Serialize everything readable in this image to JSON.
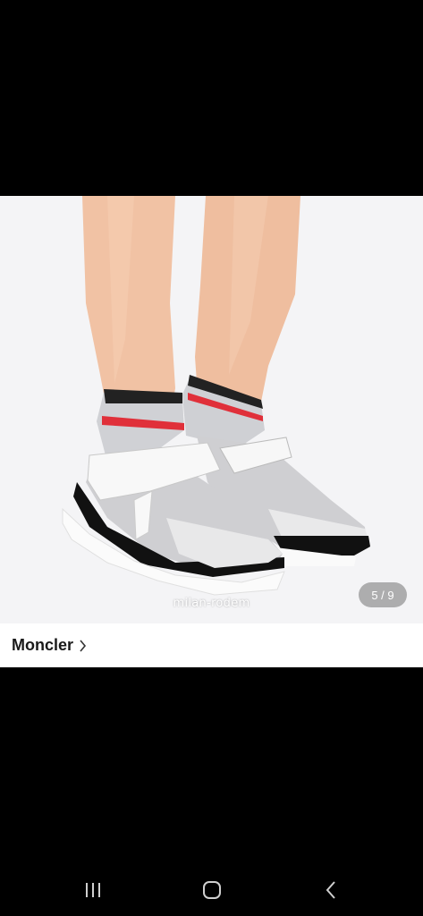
{
  "product_image": {
    "alt_icon": "sneaker-photo",
    "watermark": "milan-rodem",
    "counter": "5 / 9"
  },
  "brand": {
    "name": "Moncler",
    "chevron_icon": "chevron-right-icon"
  },
  "navbar": {
    "recents_icon": "recents-icon",
    "home_icon": "home-icon",
    "back_icon": "back-icon"
  },
  "colors": {
    "background": "#000000",
    "photo_bg": "#f4f4f6",
    "stripe_red": "#e0303a"
  }
}
